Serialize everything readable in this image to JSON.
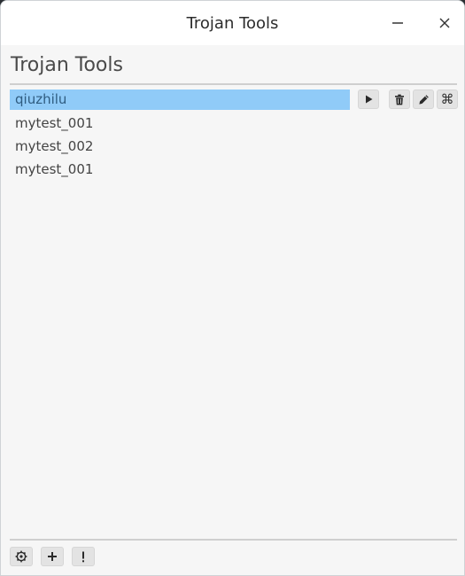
{
  "window": {
    "title": "Trojan Tools"
  },
  "page": {
    "heading": "Trojan Tools"
  },
  "profiles": {
    "items": [
      {
        "label": "qiuzhilu",
        "selected": true
      },
      {
        "label": "mytest_001",
        "selected": false
      },
      {
        "label": "mytest_002",
        "selected": false
      },
      {
        "label": "mytest_001",
        "selected": false
      }
    ]
  },
  "icons": {
    "play": "play-icon",
    "delete": "trash-icon",
    "edit": "pencil-icon",
    "command": "command-icon",
    "settings": "gear-icon",
    "add": "plus-icon",
    "info": "exclamation-icon",
    "minimize": "minimize-icon",
    "close": "close-icon"
  },
  "colors": {
    "selection": "#90cbf8",
    "selection_text": "#2f5c80"
  }
}
